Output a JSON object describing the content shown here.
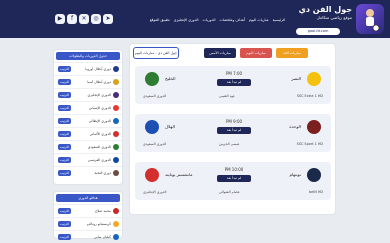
{
  "header": {
    "logo_title": "جول الفن دي",
    "logo_subtitle": "موقع رياضي متكامل",
    "logo_url": "goal-fd.com",
    "nav": [
      "الرئيسية",
      "مباريات اليوم",
      "أهداف وملخصات",
      "الدوريات",
      "الدوري الإنجليزي",
      "تطبيق الموقع"
    ],
    "social_icons": [
      "youtube-icon",
      "facebook-icon",
      "x-icon",
      "instagram-icon",
      "telegram-icon"
    ]
  },
  "sidebar_leagues": {
    "title": "جدول الدوريات والبطولات",
    "items": [
      {
        "name": "دوري أبطال أوروبا",
        "button": "الترتيب",
        "color": "#1e3a8a"
      },
      {
        "name": "دوري أبطال آسيا",
        "button": "الترتيب",
        "color": "#d9a21b"
      },
      {
        "name": "الدوري الإنجليزي",
        "button": "الترتيب",
        "color": "#4b2a7b"
      },
      {
        "name": "الدوري الإسباني",
        "button": "الترتيب",
        "color": "#e53935"
      },
      {
        "name": "الدوري الإيطالي",
        "button": "الترتيب",
        "color": "#1565c0"
      },
      {
        "name": "الدوري الألماني",
        "button": "الترتيب",
        "color": "#d32f2f"
      },
      {
        "name": "الدوري السعودي",
        "button": "الترتيب",
        "color": "#2e7d32"
      },
      {
        "name": "الدوري الفرنسي",
        "button": "الترتيب",
        "color": "#0d47a1"
      },
      {
        "name": "دوري النخبة",
        "button": "الترتيب",
        "color": "#6d4c41"
      }
    ]
  },
  "sidebar_scorers": {
    "title": "هدافو الدوري",
    "items": [
      {
        "name": "محمد صلاح",
        "button": "الترتيب",
        "color": "#c62828"
      },
      {
        "name": "كريستيانو رونالدو",
        "button": "الترتيب",
        "color": "#f9a825"
      },
      {
        "name": "كيليان مبابي",
        "button": "الترتيب",
        "color": "#1565c0"
      }
    ]
  },
  "main": {
    "tabs": [
      "مباريات الأمس",
      "مباريات اليوم",
      "مباريات الغد"
    ],
    "active_tab": "مباريات اليوم",
    "breadcrumb": "جول الفن دي - مباريات اليوم",
    "matches": [
      {
        "home": "النصر",
        "away": "الخليج",
        "time": "PM 7:00",
        "status": "لم تبدأ بعد",
        "channel": "SSC Extra 1 HD",
        "commentator": "فهد العتيبي",
        "league": "الدوري السعودي",
        "home_color": "#f4c20d",
        "away_color": "#2e7d32"
      },
      {
        "home": "الوحدة",
        "away": "الهلال",
        "time": "PM 9:00",
        "status": "لم تبدأ بعد",
        "channel": "SSC Sport 1 HD",
        "commentator": "عيسى الحربين",
        "league": "الدوري السعودي",
        "home_color": "#7b1f1f",
        "away_color": "#1e4fb3"
      },
      {
        "home": "توتنهام",
        "away": "مانشستر يونايتد",
        "time": "PM 10:00",
        "status": "لم تبدأ بعد",
        "channel": "beIN HD",
        "commentator": "عصام الشوالي",
        "league": "الدوري الإنجليزي",
        "home_color": "#1b2a4a",
        "away_color": "#d32f2f"
      }
    ]
  }
}
